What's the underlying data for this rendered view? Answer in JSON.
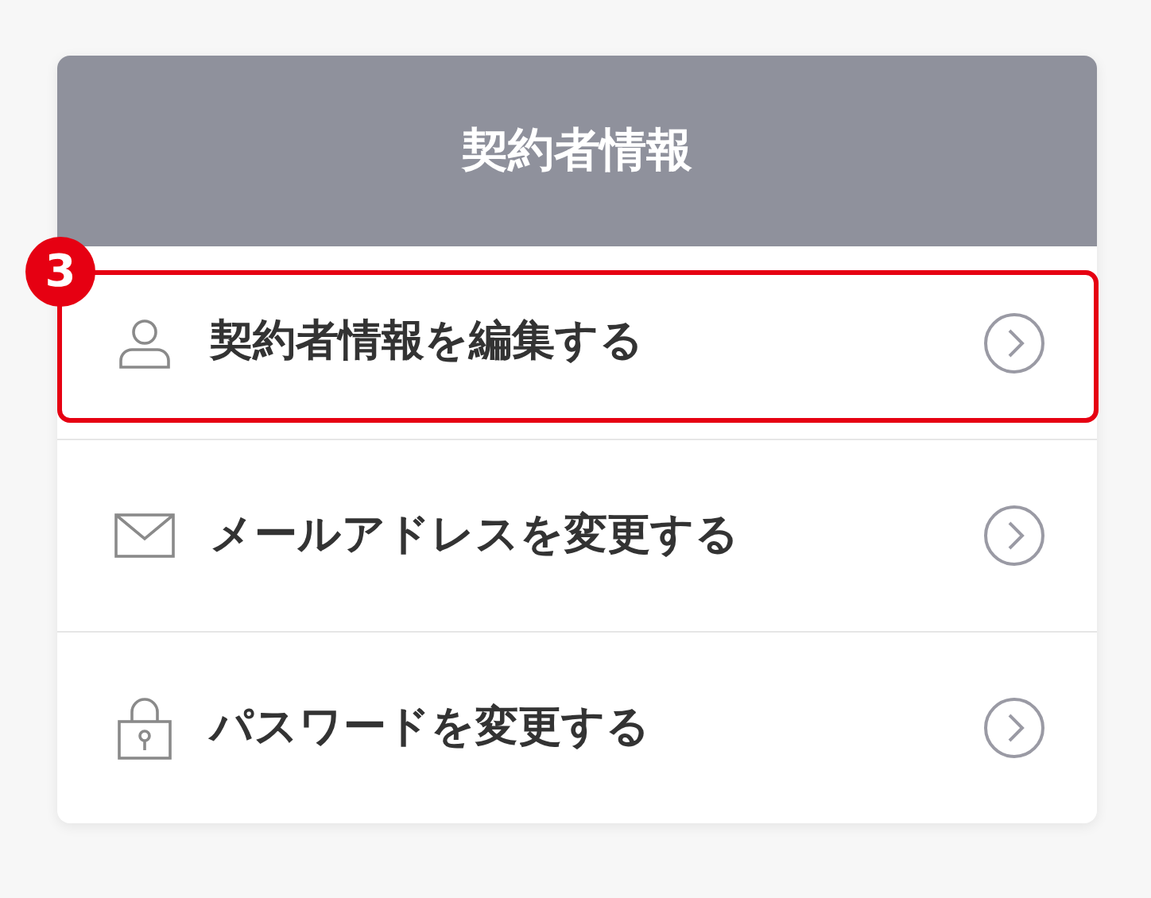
{
  "header": {
    "title": "契約者情報"
  },
  "items": [
    {
      "kind": "person",
      "label": "契約者情報を編集する",
      "highlighted": true,
      "badge": "3"
    },
    {
      "kind": "mail",
      "label": "メールアドレスを変更する",
      "highlighted": false
    },
    {
      "kind": "lock",
      "label": "パスワードを変更する",
      "highlighted": false
    }
  ]
}
